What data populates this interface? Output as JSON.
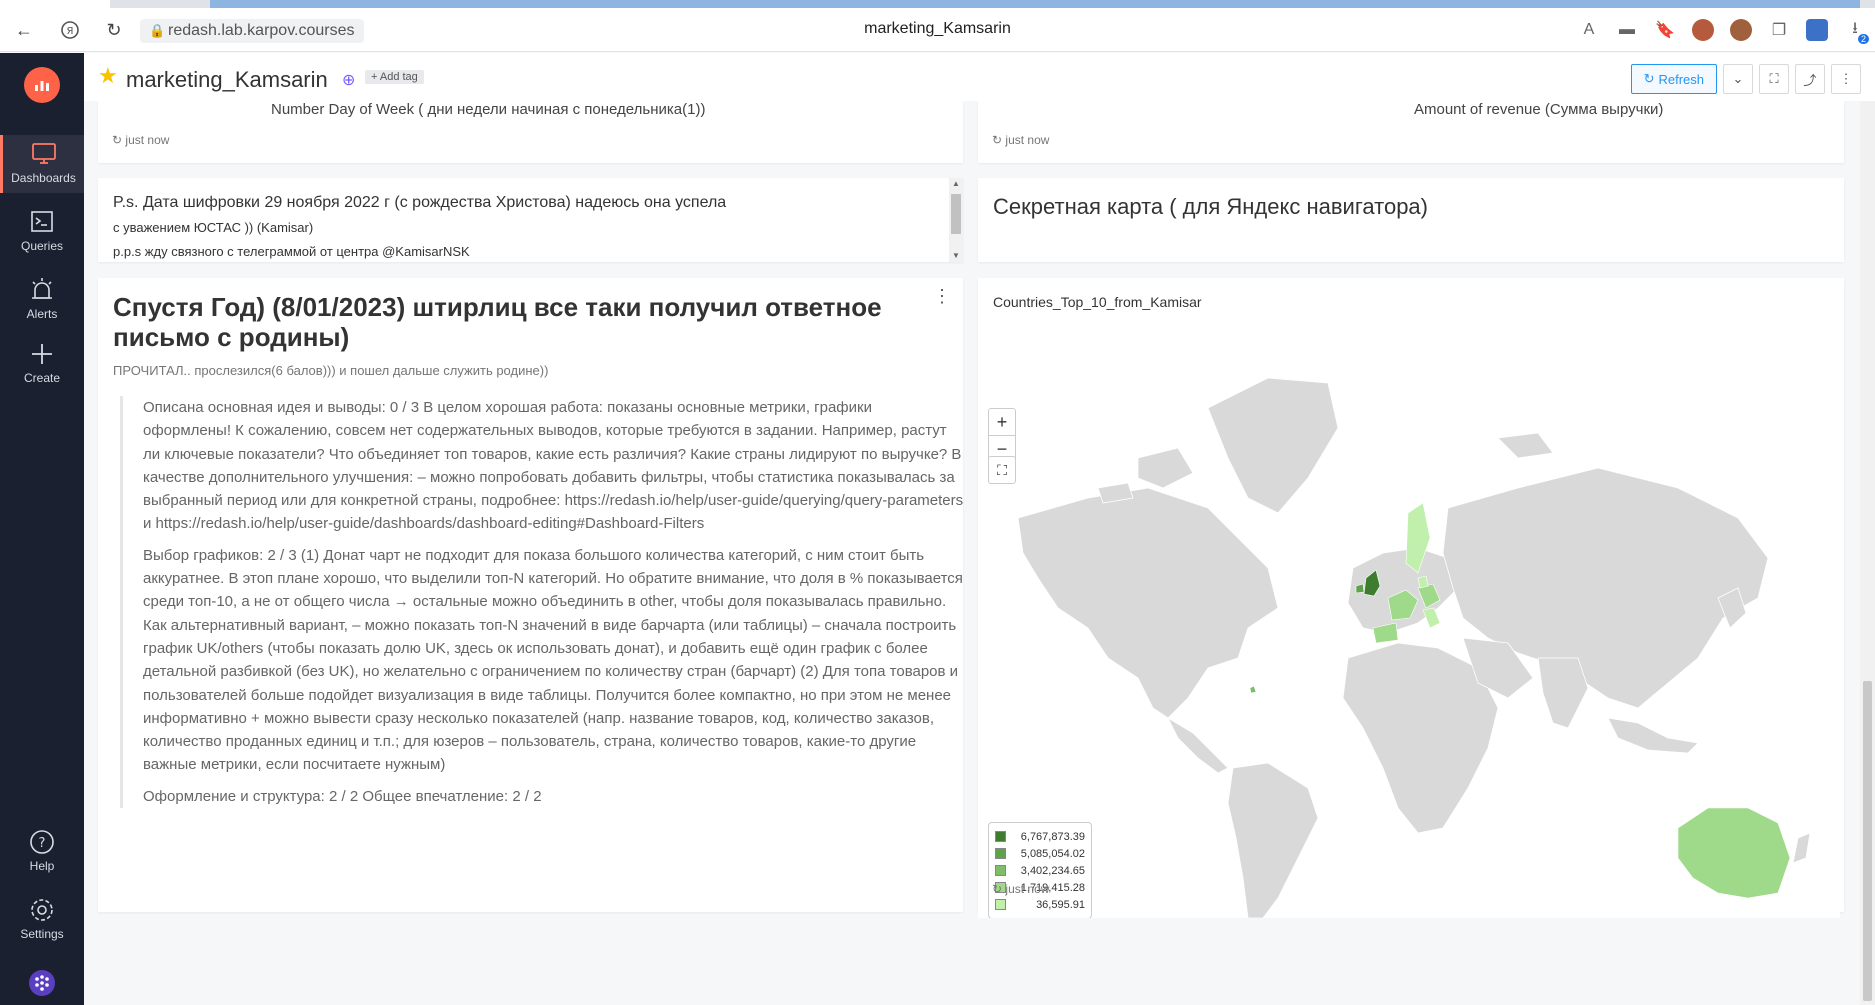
{
  "browser": {
    "url": "redash.lab.karpov.courses",
    "page_title": "marketing_Kamsarin",
    "badge_count": "2"
  },
  "sidebar": {
    "items": [
      {
        "label": "Dashboards"
      },
      {
        "label": "Queries"
      },
      {
        "label": "Alerts"
      },
      {
        "label": "Create"
      },
      {
        "label": "Help"
      },
      {
        "label": "Settings"
      }
    ]
  },
  "header": {
    "title": "marketing_Kamsarin",
    "add_tag": "+ Add tag",
    "refresh": "Refresh"
  },
  "widgets": {
    "top_left_axis_label": "Number Day of Week ( дни недели начиная с понедельника(1))",
    "top_right_axis_label": "Amount of revenue (Сумма выручки)",
    "just_now": "just now",
    "ps_title": "P.s. Дата шифровки 29 ноября 2022 г (с рождества Христова) надеюсь она успела",
    "ps_line2": "с уважением ЮСТАС )) (Kamisar)",
    "ps_line3": "p.p.s жду связного с телеграммой от центра @KamisarNSK",
    "secret_map_title": "Секретная карта ( для Яндекс навигатора)",
    "letter_title": "Спустя Год) (8/01/2023) штирлиц все таки получил ответное письмо с родины)",
    "letter_subtitle": "ПРОЧИТАЛ.. прослезился(6 балов))) и пошел дальше служить родине))",
    "review_p1": "Описана основная идея и выводы: 0 / 3 В целом хорошая работа: показаны основные метрики, графики оформлены! К сожалению, совсем нет содержательных выводов, которые требуются в задании. Например, растут ли ключевые показатели? Что объединяет топ товаров, какие есть различия? Какие страны лидируют по выручке? В качестве дополнительного улучшения: – можно попробовать добавить фильтры, чтобы статистика показывалась за выбранный период или для конкретной страны, подробнее: https://redash.io/help/user-guide/querying/query-parameters и https://redash.io/help/user-guide/dashboards/dashboard-editing#Dashboard-Filters",
    "review_p2": "Выбор графиков: 2 / 3 (1) Донат чарт не подходит для показа большого количества категорий, с ним стоит быть аккуратнее. В этоп плане хорошо, что выделили топ-N категорий. Но обратите внимание, что доля в % показывается среди топ-10, а не от общего числа → остальные можно объединить в other, чтобы доля показывалась правильно. Как альтернативный вариант, – можно показать топ-N значений в виде барчарта (или таблицы) – сначала построить график UK/others (чтобы показать долю UK, здесь ок использовать донат), и добавить ещё один график с более детальной разбивкой (без UK), но желательно с ограничением по количеству стран (барчарт) (2) Для топа товаров и пользователей больше подойдет визуализация в виде таблицы. Получится более компактно, но при этом не менее информативно + можно вывести сразу несколько показателей (напр. название товаров, код, количество заказов, количество проданных единиц и т.п.; для юзеров – пользователь, страна, количество товаров, какие-то другие важные метрики, если посчитаете нужным)",
    "review_p3": "Оформление и структура: 2 / 2 Общее впечатление: 2 / 2",
    "map_title": "Countries_Top_10_from_Kamisar"
  },
  "map": {
    "zoom_in": "+",
    "zoom_out": "−",
    "legend": [
      {
        "value": "6,767,873.39",
        "color": "#3e7d30"
      },
      {
        "value": "5,085,054.02",
        "color": "#5ea24c"
      },
      {
        "value": "3,402,234.65",
        "color": "#7ebe68"
      },
      {
        "value": "1,719,415.28",
        "color": "#9fd98a"
      },
      {
        "value": "36,595.91",
        "color": "#c1f0ac"
      }
    ]
  }
}
